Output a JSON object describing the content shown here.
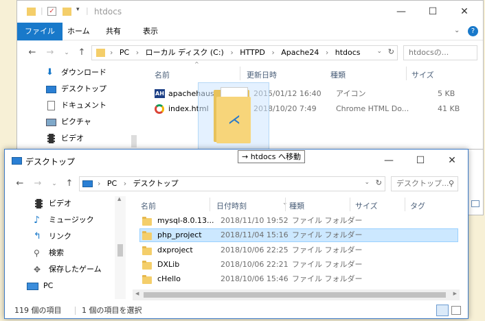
{
  "back_window": {
    "title": "htdocs",
    "ribbon_tabs": [
      "ファイル",
      "ホーム",
      "共有",
      "表示"
    ],
    "breadcrumbs": [
      "PC",
      "ローカル ディスク (C:)",
      "HTTPD",
      "Apache24",
      "htdocs"
    ],
    "search_placeholder": "htdocsの...",
    "sidebar": [
      "ダウンロード",
      "デスクトップ",
      "ドキュメント",
      "ピクチャ",
      "ビデオ"
    ],
    "columns": [
      "名前",
      "更新日時",
      "種類",
      "サイズ"
    ],
    "files": [
      {
        "name": "apachehaus.ico",
        "date": "2015/01/12 16:40",
        "type": "アイコン",
        "size": "5 KB",
        "icon": "apache-ico-icon"
      },
      {
        "name": "index.html",
        "date": "2018/10/20 7:49",
        "type": "Chrome HTML Do...",
        "size": "41 KB",
        "icon": "chrome-icon"
      }
    ]
  },
  "front_window": {
    "title": "デスクトップ",
    "breadcrumbs": [
      "PC",
      "デスクトップ"
    ],
    "search_placeholder": "デスクトップ...",
    "sidebar": [
      "ビデオ",
      "ミュージック",
      "リンク",
      "検索",
      "保存したゲーム",
      "PC"
    ],
    "columns": [
      "名前",
      "日付時刻",
      "種類",
      "サイズ",
      "タグ"
    ],
    "rows": [
      {
        "name": "mysql-8.0.13...",
        "date": "2018/11/10 19:52",
        "type": "ファイル フォルダー",
        "selected": false
      },
      {
        "name": "php_project",
        "date": "2018/11/04 15:16",
        "type": "ファイル フォルダー",
        "selected": true
      },
      {
        "name": "dxproject",
        "date": "2018/10/06 22:25",
        "type": "ファイル フォルダー",
        "selected": false
      },
      {
        "name": "DXLib",
        "date": "2018/10/06 22:21",
        "type": "ファイル フォルダー",
        "selected": false
      },
      {
        "name": "cHello",
        "date": "2018/10/06 15:46",
        "type": "ファイル フォルダー",
        "selected": false
      }
    ],
    "status_count": "119 個の項目",
    "status_selected": "1 個の項目を選択"
  },
  "drag_tooltip": "→ htdocs へ移動",
  "colors": {
    "accent": "#1979ca",
    "selection": "#cce8ff",
    "folder": "#f4ce6a"
  }
}
